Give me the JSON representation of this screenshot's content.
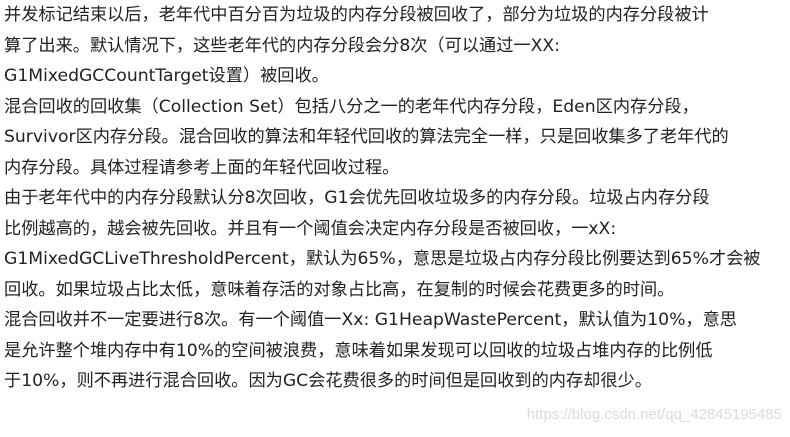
{
  "paragraphs": [
    {
      "lines": [
        "并发标记结束以后，老年代中百分百为垃圾的内存分段被回收了，部分为垃圾的内存分段被计",
        "算了出来。默认情况下，这些老年代的内存分段会分8次（可以通过一XX:",
        "G1MixedGCCountTarget设置）被回收。"
      ]
    },
    {
      "lines": [
        "混合回收的回收集（Collection Set）包括八分之一的老年代内存分段，Eden区内存分段，",
        "Survivor区内存分段。混合回收的算法和年轻代回收的算法完全一样，只是回收集多了老年代的",
        "内存分段。具体过程请参考上面的年轻代回收过程。"
      ]
    },
    {
      "lines": [
        "由于老年代中的内存分段默认分8次回收，G1会优先回收垃圾多的内存分段。垃圾占内存分段",
        "比例越高的，越会被先回收。并且有一个阈值会决定内存分段是否被回收，一xX:",
        "G1MixedGCLiveThresholdPercent，默认为65%，意思是垃圾占内存分段比例要达到65%才会被",
        "回收。如果垃圾占比太低，意味着存活的对象占比高，在复制的时候会花费更多的时间。"
      ]
    },
    {
      "lines": [
        "混合回收并不一定要进行8次。有一个阈值一Xx:  G1HeapWastePercent，默认值为10%，意思",
        "是允许整个堆内存中有10%的空间被浪费，意味着如果发现可以回收的垃圾占堆内存的比例低",
        "于10%，则不再进行混合回收。因为GC会花费很多的时间但是回收到的内存却很少。"
      ]
    }
  ],
  "watermark": "https://blog.csdn.net/qq_42845195485",
  "colors": {
    "background": "#ffffff",
    "text": "#222222"
  }
}
